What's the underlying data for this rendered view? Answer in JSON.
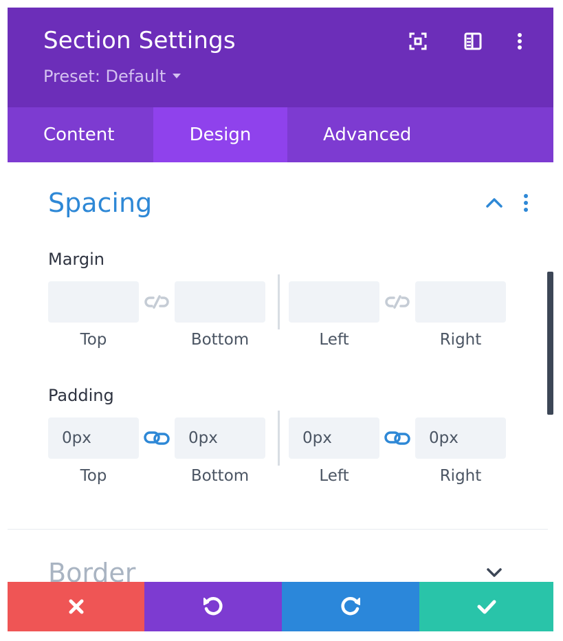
{
  "header": {
    "title": "Section Settings",
    "preset": "Preset: Default",
    "icons": [
      "focus-mode-icon",
      "sidebar-layout-icon",
      "more-vertical-icon"
    ]
  },
  "tabs": [
    {
      "label": "Content",
      "active": false
    },
    {
      "label": "Design",
      "active": true
    },
    {
      "label": "Advanced",
      "active": false
    }
  ],
  "section": {
    "title": "Spacing",
    "expanded": true,
    "margin": {
      "label": "Margin",
      "fields": [
        {
          "label": "Top",
          "value": ""
        },
        {
          "label": "Bottom",
          "value": ""
        },
        {
          "label": "Left",
          "value": ""
        },
        {
          "label": "Right",
          "value": ""
        }
      ],
      "linked": false
    },
    "padding": {
      "label": "Padding",
      "fields": [
        {
          "label": "Top",
          "value": "0px"
        },
        {
          "label": "Bottom",
          "value": "0px"
        },
        {
          "label": "Left",
          "value": "0px"
        },
        {
          "label": "Right",
          "value": "0px"
        }
      ],
      "linked": true
    }
  },
  "next_section": {
    "title": "Border",
    "expanded": false
  },
  "footer": {
    "buttons": [
      "discard-icon",
      "undo-icon",
      "redo-icon",
      "save-check-icon"
    ]
  },
  "colors": {
    "header_bg": "#6c2eb9",
    "tabs_bg": "#7d3bd1",
    "active_tab_bg": "#8f42ec",
    "accent_blue": "#2e88d6",
    "discard": "#ef5555",
    "undo": "#7d3bd1",
    "redo": "#2b87da",
    "save": "#29c4a9"
  }
}
